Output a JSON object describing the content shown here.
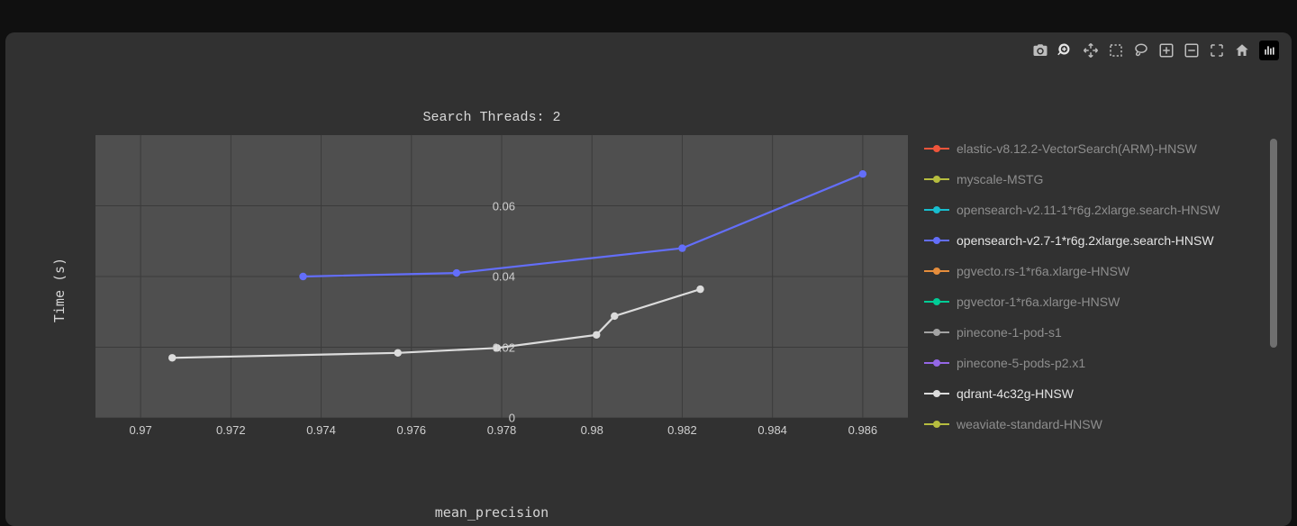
{
  "chart_data": {
    "type": "line",
    "title": "Search Threads: 2",
    "xlabel": "mean_precision",
    "ylabel": "Time (s)",
    "xlim": [
      0.969,
      0.987
    ],
    "ylim": [
      0,
      0.08
    ],
    "x_ticks": [
      0.97,
      0.972,
      0.974,
      0.976,
      0.978,
      0.98,
      0.982,
      0.984,
      0.986
    ],
    "y_ticks": [
      0,
      0.02,
      0.04,
      0.06
    ],
    "visible_series": [
      "opensearch-v2.7-1*r6g.2xlarge.search-HNSW",
      "qdrant-4c32g-HNSW"
    ],
    "series": [
      {
        "name": "opensearch-v2.7-1*r6g.2xlarge.search-HNSW",
        "color": "#636efa",
        "points": [
          {
            "x": 0.9736,
            "y": 0.04
          },
          {
            "x": 0.977,
            "y": 0.041
          },
          {
            "x": 0.982,
            "y": 0.048
          },
          {
            "x": 0.986,
            "y": 0.069
          }
        ]
      },
      {
        "name": "qdrant-4c32g-HNSW",
        "color": "#dcdcdc",
        "points": [
          {
            "x": 0.9707,
            "y": 0.017
          },
          {
            "x": 0.9757,
            "y": 0.0184
          },
          {
            "x": 0.9779,
            "y": 0.0198
          },
          {
            "x": 0.9801,
            "y": 0.0235
          },
          {
            "x": 0.9805,
            "y": 0.0288
          },
          {
            "x": 0.9824,
            "y": 0.0364
          }
        ]
      }
    ]
  },
  "legend": {
    "items": [
      {
        "label": "elastic-v8.12.2-VectorSearch(ARM)-HNSW",
        "color": "#ef553b",
        "active": false
      },
      {
        "label": "myscale-MSTG",
        "color": "#b6bd3f",
        "active": false
      },
      {
        "label": "opensearch-v2.11-1*r6g.2xlarge.search-HNSW",
        "color": "#18becf",
        "active": false
      },
      {
        "label": "opensearch-v2.7-1*r6g.2xlarge.search-HNSW",
        "color": "#636efa",
        "active": true
      },
      {
        "label": "pgvecto.rs-1*r6a.xlarge-HNSW",
        "color": "#e58d3c",
        "active": false
      },
      {
        "label": "pgvector-1*r6a.xlarge-HNSW",
        "color": "#00cc96",
        "active": false
      },
      {
        "label": "pinecone-1-pod-s1",
        "color": "#a3a3a3",
        "active": false
      },
      {
        "label": "pinecone-5-pods-p2.x1",
        "color": "#9467e6",
        "active": false
      },
      {
        "label": "qdrant-4c32g-HNSW",
        "color": "#dcdcdc",
        "active": true
      },
      {
        "label": "weaviate-standard-HNSW",
        "color": "#b6bd3f",
        "active": false
      }
    ]
  },
  "toolbar": {
    "camera": "Download plot as PNG",
    "zoom": "Zoom",
    "pan": "Pan",
    "box": "Box Select",
    "lasso": "Lasso Select",
    "zoom_in": "Zoom in",
    "zoom_out": "Zoom out",
    "autoscale": "Autoscale",
    "reset": "Reset axes",
    "plotly": "Produced with Plotly"
  }
}
